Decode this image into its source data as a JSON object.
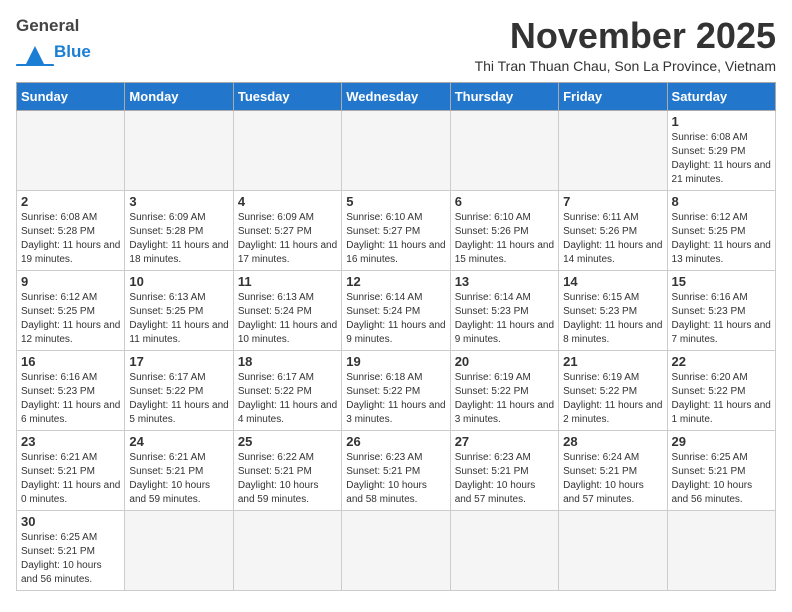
{
  "header": {
    "logo_general": "General",
    "logo_blue": "Blue",
    "month_title": "November 2025",
    "subtitle": "Thi Tran Thuan Chau, Son La Province, Vietnam"
  },
  "weekdays": [
    "Sunday",
    "Monday",
    "Tuesday",
    "Wednesday",
    "Thursday",
    "Friday",
    "Saturday"
  ],
  "weeks": [
    [
      {
        "day": "",
        "info": ""
      },
      {
        "day": "",
        "info": ""
      },
      {
        "day": "",
        "info": ""
      },
      {
        "day": "",
        "info": ""
      },
      {
        "day": "",
        "info": ""
      },
      {
        "day": "",
        "info": ""
      },
      {
        "day": "1",
        "info": "Sunrise: 6:08 AM\nSunset: 5:29 PM\nDaylight: 11 hours\nand 21 minutes."
      }
    ],
    [
      {
        "day": "2",
        "info": "Sunrise: 6:08 AM\nSunset: 5:28 PM\nDaylight: 11 hours\nand 19 minutes."
      },
      {
        "day": "3",
        "info": "Sunrise: 6:09 AM\nSunset: 5:28 PM\nDaylight: 11 hours\nand 18 minutes."
      },
      {
        "day": "4",
        "info": "Sunrise: 6:09 AM\nSunset: 5:27 PM\nDaylight: 11 hours\nand 17 minutes."
      },
      {
        "day": "5",
        "info": "Sunrise: 6:10 AM\nSunset: 5:27 PM\nDaylight: 11 hours\nand 16 minutes."
      },
      {
        "day": "6",
        "info": "Sunrise: 6:10 AM\nSunset: 5:26 PM\nDaylight: 11 hours\nand 15 minutes."
      },
      {
        "day": "7",
        "info": "Sunrise: 6:11 AM\nSunset: 5:26 PM\nDaylight: 11 hours\nand 14 minutes."
      },
      {
        "day": "8",
        "info": "Sunrise: 6:12 AM\nSunset: 5:25 PM\nDaylight: 11 hours\nand 13 minutes."
      }
    ],
    [
      {
        "day": "9",
        "info": "Sunrise: 6:12 AM\nSunset: 5:25 PM\nDaylight: 11 hours\nand 12 minutes."
      },
      {
        "day": "10",
        "info": "Sunrise: 6:13 AM\nSunset: 5:25 PM\nDaylight: 11 hours\nand 11 minutes."
      },
      {
        "day": "11",
        "info": "Sunrise: 6:13 AM\nSunset: 5:24 PM\nDaylight: 11 hours\nand 10 minutes."
      },
      {
        "day": "12",
        "info": "Sunrise: 6:14 AM\nSunset: 5:24 PM\nDaylight: 11 hours\nand 9 minutes."
      },
      {
        "day": "13",
        "info": "Sunrise: 6:14 AM\nSunset: 5:23 PM\nDaylight: 11 hours\nand 9 minutes."
      },
      {
        "day": "14",
        "info": "Sunrise: 6:15 AM\nSunset: 5:23 PM\nDaylight: 11 hours\nand 8 minutes."
      },
      {
        "day": "15",
        "info": "Sunrise: 6:16 AM\nSunset: 5:23 PM\nDaylight: 11 hours\nand 7 minutes."
      }
    ],
    [
      {
        "day": "16",
        "info": "Sunrise: 6:16 AM\nSunset: 5:23 PM\nDaylight: 11 hours\nand 6 minutes."
      },
      {
        "day": "17",
        "info": "Sunrise: 6:17 AM\nSunset: 5:22 PM\nDaylight: 11 hours\nand 5 minutes."
      },
      {
        "day": "18",
        "info": "Sunrise: 6:17 AM\nSunset: 5:22 PM\nDaylight: 11 hours\nand 4 minutes."
      },
      {
        "day": "19",
        "info": "Sunrise: 6:18 AM\nSunset: 5:22 PM\nDaylight: 11 hours\nand 3 minutes."
      },
      {
        "day": "20",
        "info": "Sunrise: 6:19 AM\nSunset: 5:22 PM\nDaylight: 11 hours\nand 3 minutes."
      },
      {
        "day": "21",
        "info": "Sunrise: 6:19 AM\nSunset: 5:22 PM\nDaylight: 11 hours\nand 2 minutes."
      },
      {
        "day": "22",
        "info": "Sunrise: 6:20 AM\nSunset: 5:22 PM\nDaylight: 11 hours\nand 1 minute."
      }
    ],
    [
      {
        "day": "23",
        "info": "Sunrise: 6:21 AM\nSunset: 5:21 PM\nDaylight: 11 hours\nand 0 minutes."
      },
      {
        "day": "24",
        "info": "Sunrise: 6:21 AM\nSunset: 5:21 PM\nDaylight: 10 hours\nand 59 minutes."
      },
      {
        "day": "25",
        "info": "Sunrise: 6:22 AM\nSunset: 5:21 PM\nDaylight: 10 hours\nand 59 minutes."
      },
      {
        "day": "26",
        "info": "Sunrise: 6:23 AM\nSunset: 5:21 PM\nDaylight: 10 hours\nand 58 minutes."
      },
      {
        "day": "27",
        "info": "Sunrise: 6:23 AM\nSunset: 5:21 PM\nDaylight: 10 hours\nand 57 minutes."
      },
      {
        "day": "28",
        "info": "Sunrise: 6:24 AM\nSunset: 5:21 PM\nDaylight: 10 hours\nand 57 minutes."
      },
      {
        "day": "29",
        "info": "Sunrise: 6:25 AM\nSunset: 5:21 PM\nDaylight: 10 hours\nand 56 minutes."
      }
    ],
    [
      {
        "day": "30",
        "info": "Sunrise: 6:25 AM\nSunset: 5:21 PM\nDaylight: 10 hours\nand 56 minutes."
      },
      {
        "day": "",
        "info": ""
      },
      {
        "day": "",
        "info": ""
      },
      {
        "day": "",
        "info": ""
      },
      {
        "day": "",
        "info": ""
      },
      {
        "day": "",
        "info": ""
      },
      {
        "day": "",
        "info": ""
      }
    ]
  ]
}
